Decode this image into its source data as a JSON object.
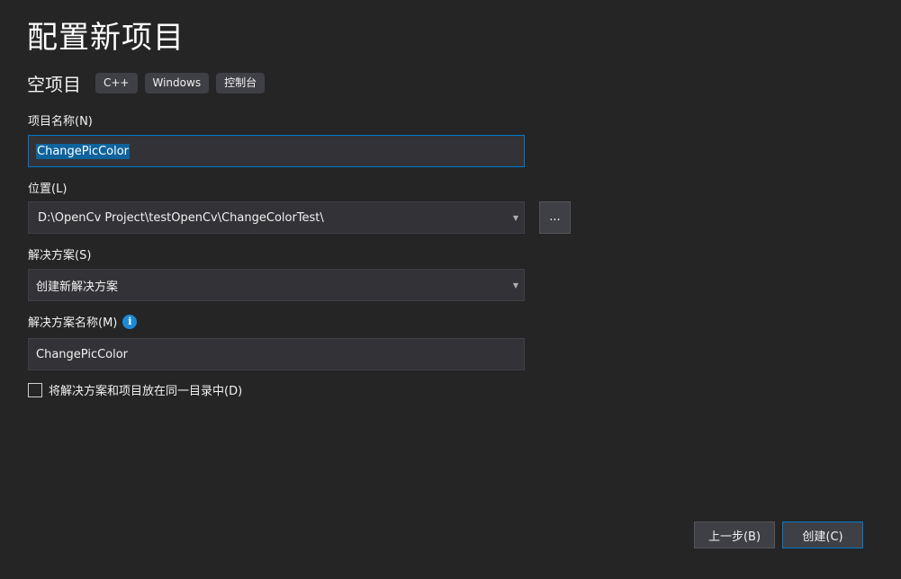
{
  "header": {
    "title": "配置新项目"
  },
  "template": {
    "name": "空项目",
    "tags": [
      "C++",
      "Windows",
      "控制台"
    ]
  },
  "project_name": {
    "label": "项目名称(N)",
    "value": "ChangePicColor"
  },
  "location": {
    "label": "位置(L)",
    "value": "D:\\OpenCv Project\\testOpenCv\\ChangeColorTest\\",
    "browse_label": "..."
  },
  "solution": {
    "label": "解决方案(S)",
    "value": "创建新解决方案"
  },
  "solution_name": {
    "label": "解决方案名称(M)",
    "value": "ChangePicColor",
    "info_icon": "info-icon"
  },
  "same_dir": {
    "label": "将解决方案和项目放在同一目录中(D)",
    "checked": false
  },
  "footer": {
    "back_label": "上一步(B)",
    "create_label": "创建(C)"
  },
  "colors": {
    "background": "#252526",
    "field": "#333337",
    "accent": "#007acc",
    "selection": "#0e639c"
  }
}
